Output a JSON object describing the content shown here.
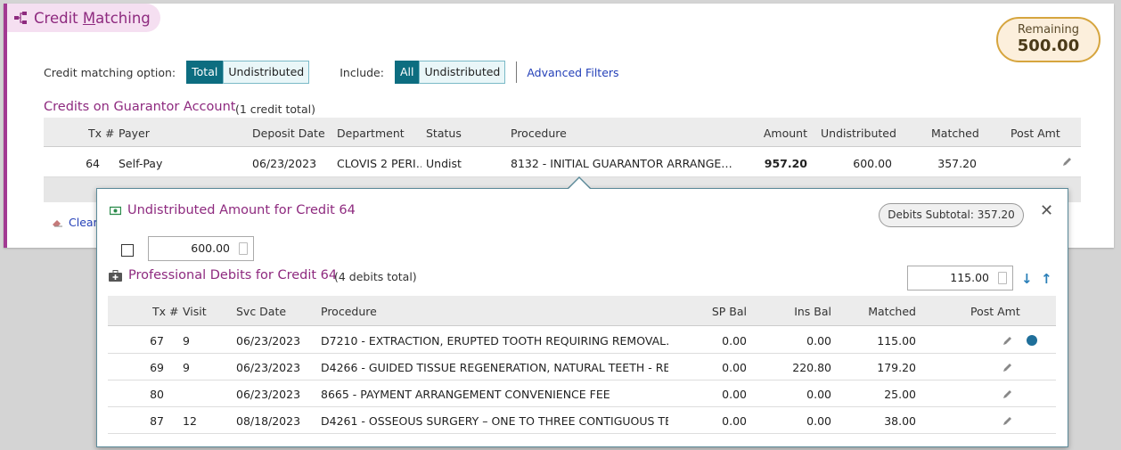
{
  "header": {
    "title_before": "Credit ",
    "title_underlined": "M",
    "title_after": "atching",
    "remaining_label": "Remaining",
    "remaining_value": "500.00"
  },
  "options": {
    "matching_label": "Credit matching option:",
    "matching_options": [
      "Total",
      "Undistributed"
    ],
    "matching_selected": "Total",
    "include_label": "Include:",
    "include_options": [
      "All",
      "Undistributed"
    ],
    "include_selected": "All",
    "advanced_filters": "Advanced Filters"
  },
  "credits": {
    "title": "Credits on Guarantor Account",
    "count": "(1 credit total)",
    "columns": [
      "Tx #",
      "Payer",
      "Deposit Date",
      "Department",
      "Status",
      "Procedure",
      "Amount",
      "Undistributed",
      "Matched",
      "Post Amt"
    ],
    "rows": [
      {
        "tx": "64",
        "payer": "Self-Pay",
        "deposit_date": "06/23/2023",
        "department": "CLOVIS 2 PERI…",
        "status": "Undist",
        "procedure": "8132 - INITIAL GUARANTOR ARRANGE…",
        "amount": "957.20",
        "undistributed": "600.00",
        "matched": "357.20"
      }
    ]
  },
  "clear_label": "Clear",
  "popup": {
    "undist_title": "Undistributed Amount for Credit 64",
    "debits_subtotal": "Debits Subtotal: 357.20",
    "undist_value": "600.00",
    "debits_title": "Professional Debits for Credit 64",
    "debits_count": "(4 debits total)",
    "filter_value": "115.00",
    "columns": [
      "Tx #",
      "Visit",
      "Svc Date",
      "Procedure",
      "SP Bal",
      "Ins Bal",
      "Matched",
      "Post Amt"
    ],
    "rows": [
      {
        "tx": "67",
        "visit": "9",
        "svc_date": "06/23/2023",
        "procedure": "D7210 - EXTRACTION, ERUPTED TOOTH REQUIRING REMOVAL…",
        "sp_bal": "0.00",
        "ins_bal": "0.00",
        "matched": "115.00"
      },
      {
        "tx": "69",
        "visit": "9",
        "svc_date": "06/23/2023",
        "procedure": "D4266 - GUIDED TISSUE REGENERATION, NATURAL TEETH - RE…",
        "sp_bal": "0.00",
        "ins_bal": "220.80",
        "matched": "179.20"
      },
      {
        "tx": "80",
        "visit": "",
        "svc_date": "06/23/2023",
        "procedure": "8665 - PAYMENT ARRANGEMENT CONVENIENCE FEE",
        "sp_bal": "0.00",
        "ins_bal": "0.00",
        "matched": "25.00"
      },
      {
        "tx": "87",
        "visit": "12",
        "svc_date": "08/18/2023",
        "procedure": "D4261 - OSSEOUS SURGERY – ONE TO THREE CONTIGUOUS TE…",
        "sp_bal": "0.00",
        "ins_bal": "0.00",
        "matched": "38.00"
      }
    ]
  },
  "colors": {
    "accent": "#8e2a7f",
    "selected": "#0d6d80",
    "link": "#2440b8",
    "remaining_border": "#d6a53e"
  }
}
